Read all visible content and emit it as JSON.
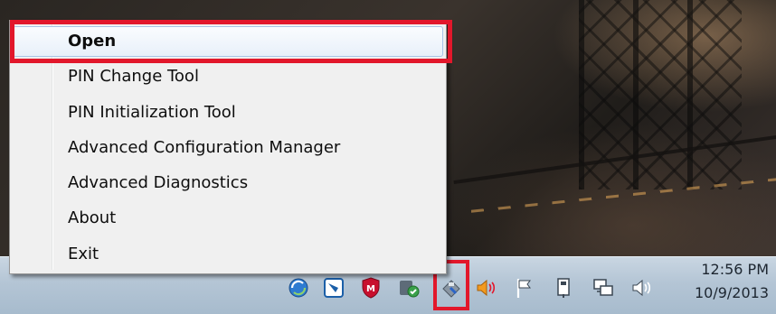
{
  "context_menu": {
    "items": [
      {
        "label": "Open",
        "bold": true
      },
      {
        "label": "PIN Change Tool"
      },
      {
        "label": "PIN Initialization Tool"
      },
      {
        "label": "Advanced Configuration Manager"
      },
      {
        "label": "Advanced Diagnostics"
      },
      {
        "label": "About"
      },
      {
        "label": "Exit"
      }
    ]
  },
  "highlight_color": "#e2172b",
  "taskbar": {
    "tray_icons": [
      "network-sync-icon",
      "blue-app-icon",
      "mcafee-shield-icon",
      "security-check-icon",
      "smart-card-reader-icon",
      "speaker-alert-icon",
      "action-center-flag-icon",
      "safely-remove-hardware-icon",
      "network-icon",
      "volume-icon"
    ],
    "clock": {
      "time": "12:56 PM",
      "date": "10/9/2013"
    }
  }
}
